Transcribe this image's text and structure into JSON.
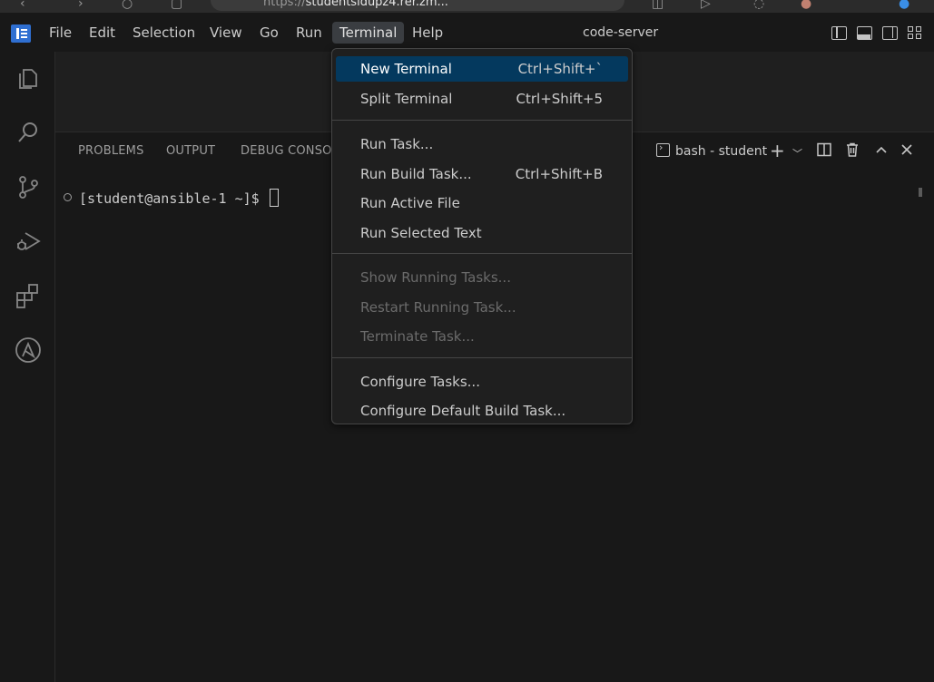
{
  "browser": {
    "url_scheme": "https://",
    "url_host": "studentsidupz4.rer.zm..."
  },
  "menubar": {
    "items": [
      "File",
      "Edit",
      "Selection",
      "View",
      "Go",
      "Run",
      "Terminal",
      "Help"
    ],
    "active": "Terminal"
  },
  "window_title": "code-server",
  "panel": {
    "tabs": [
      "PROBLEMS",
      "OUTPUT",
      "DEBUG CONSOLE"
    ],
    "terminal_name": "bash - student"
  },
  "terminal": {
    "prompt": "[student@ansible-1 ~]$ "
  },
  "terminal_menu": {
    "groups": [
      [
        {
          "label": "New Terminal",
          "shortcut": "Ctrl+Shift+`",
          "selected": true
        },
        {
          "label": "Split Terminal",
          "shortcut": "Ctrl+Shift+5"
        }
      ],
      [
        {
          "label": "Run Task..."
        },
        {
          "label": "Run Build Task...",
          "shortcut": "Ctrl+Shift+B"
        },
        {
          "label": "Run Active File"
        },
        {
          "label": "Run Selected Text"
        }
      ],
      [
        {
          "label": "Show Running Tasks...",
          "disabled": true
        },
        {
          "label": "Restart Running Task...",
          "disabled": true
        },
        {
          "label": "Terminate Task...",
          "disabled": true
        }
      ],
      [
        {
          "label": "Configure Tasks..."
        },
        {
          "label": "Configure Default Build Task..."
        }
      ]
    ]
  },
  "colors": {
    "accent": "#04395e",
    "background": "#1f1f1f",
    "sidebar": "#181818"
  },
  "icons": [
    "explorer-icon",
    "search-icon",
    "source-control-icon",
    "run-debug-icon",
    "extensions-icon",
    "ansible-icon"
  ]
}
